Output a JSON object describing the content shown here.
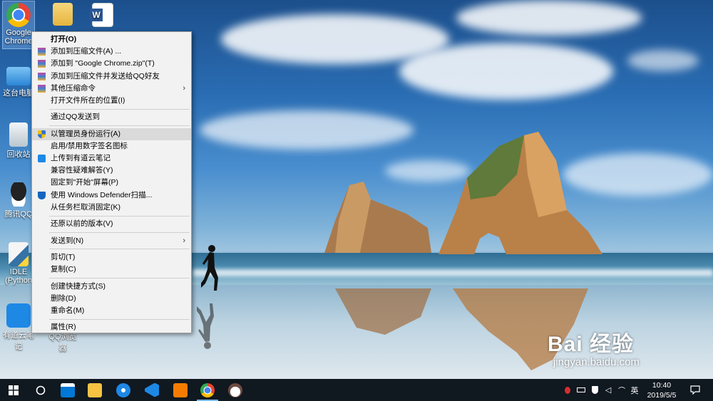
{
  "desktop": {
    "icons": [
      {
        "label": "Google Chrome",
        "icon": "chrome-icon"
      },
      {
        "label": "",
        "icon": "folder-icon"
      },
      {
        "label": "",
        "icon": "word-icon"
      },
      {
        "label": "这台电脑",
        "icon": "computer-icon"
      },
      {
        "label": "回收站",
        "icon": "recycle-bin-icon"
      },
      {
        "label": "腾讯QQ",
        "icon": "qq-icon"
      },
      {
        "label": "IDLE (Python",
        "icon": "python-icon"
      },
      {
        "label": "有道云笔记",
        "icon": "youdao-note-icon"
      },
      {
        "label": "QQ浏览器",
        "icon": "qq-browser-icon"
      }
    ]
  },
  "context_menu": {
    "items": [
      {
        "label": "打开(O)"
      },
      {
        "label": "添加到压缩文件(A) ..."
      },
      {
        "label": "添加到 \"Google Chrome.zip\"(T)"
      },
      {
        "label": "添加到压缩文件并发送给QQ好友"
      },
      {
        "label": "其他压缩命令"
      },
      {
        "label": "打开文件所在的位置(I)"
      },
      {
        "label": "通过QQ发送到"
      },
      {
        "label": "以管理员身份运行(A)"
      },
      {
        "label": "启用/禁用数字签名图标"
      },
      {
        "label": "上传到有道云笔记"
      },
      {
        "label": "兼容性疑难解答(Y)"
      },
      {
        "label": "固定到\"开始\"屏幕(P)"
      },
      {
        "label": "使用 Windows Defender扫描..."
      },
      {
        "label": "从任务栏取消固定(K)"
      },
      {
        "label": "还原以前的版本(V)"
      },
      {
        "label": "发送到(N)"
      },
      {
        "label": "剪切(T)"
      },
      {
        "label": "复制(C)"
      },
      {
        "label": "创建快捷方式(S)"
      },
      {
        "label": "删除(D)"
      },
      {
        "label": "重命名(M)"
      },
      {
        "label": "属性(R)"
      }
    ]
  },
  "taskbar": {
    "apps": [
      "windows-start-icon",
      "cortana-icon",
      "store-icon",
      "sticky-icon",
      "browser-icon",
      "vscode-icon",
      "media-icon",
      "chrome-icon",
      "coffee-icon"
    ],
    "tray": {
      "ime": "英",
      "time": "10:40",
      "date": "2019/5/5"
    }
  },
  "watermark": {
    "logo": "Bai 经验",
    "url": "jingyan.baidu.com"
  },
  "colors": {
    "menu_bg": "#f2f2f2",
    "menu_hover": "#dadada",
    "taskbar": "#101820",
    "accent": "#76b9ed"
  }
}
